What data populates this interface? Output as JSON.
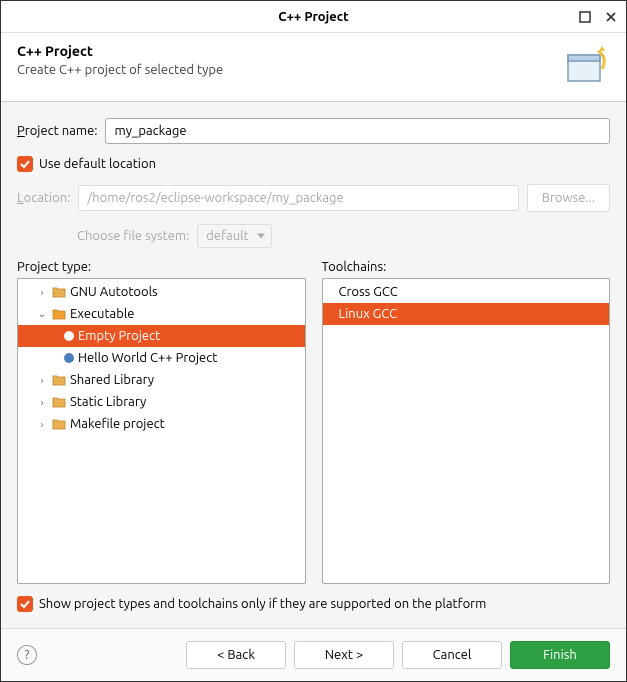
{
  "titlebar": {
    "title": "C++ Project"
  },
  "header": {
    "title": "C++ Project",
    "description": "Create C++ project of selected type"
  },
  "form": {
    "projectNameLabel": "Project name:",
    "projectNameValue": "my_package",
    "useDefaultLabel": "Use default location",
    "useDefaultChecked": true,
    "locationLabel": "Location:",
    "locationValue": "/home/ros2/eclipse-workspace/my_package",
    "browseLabel": "Browse...",
    "fileSystemLabel": "Choose file system:",
    "fileSystemValue": "default"
  },
  "panels": {
    "projectTypeLabel": "Project type:",
    "toolchainsLabel": "Toolchains:"
  },
  "projectTypes": [
    {
      "label": "GNU Autotools",
      "expanded": false,
      "depth": 0,
      "type": "folder"
    },
    {
      "label": "Executable",
      "expanded": true,
      "depth": 0,
      "type": "folder"
    },
    {
      "label": "Empty Project",
      "depth": 1,
      "type": "leaf",
      "selected": true,
      "icon": "blue"
    },
    {
      "label": "Hello World C++ Project",
      "depth": 1,
      "type": "leaf",
      "icon": "blue"
    },
    {
      "label": "Shared Library",
      "expanded": false,
      "depth": 0,
      "type": "folder"
    },
    {
      "label": "Static Library",
      "expanded": false,
      "depth": 0,
      "type": "folder"
    },
    {
      "label": "Makefile project",
      "expanded": false,
      "depth": 0,
      "type": "folder"
    }
  ],
  "toolchains": [
    {
      "label": "Cross GCC",
      "selected": false
    },
    {
      "label": "Linux GCC",
      "selected": true
    }
  ],
  "supportedOnly": {
    "label": "Show project types and toolchains only if they are supported on the platform",
    "checked": true
  },
  "footer": {
    "back": "< Back",
    "next": "Next >",
    "cancel": "Cancel",
    "finish": "Finish"
  }
}
